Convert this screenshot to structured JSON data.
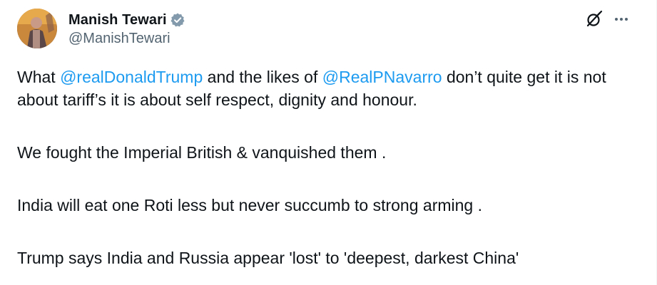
{
  "author": {
    "display_name": "Manish Tewari",
    "handle": "@ManishTewari",
    "verified_badge_color": "#1d9bf0"
  },
  "icons": {
    "grok": "grok-icon",
    "more": "more-options-icon",
    "verified": "verified-badge-icon"
  },
  "tweet": {
    "p1_before": "What ",
    "p1_mention1": "@realDonaldTrump",
    "p1_middle": " and the likes of ",
    "p1_mention2": "@RealPNavarro",
    "p1_after": " don’t quite get it is not about tariff’s it is about self respect, dignity and honour.",
    "p2": "We fought the Imperial British & vanquished them .",
    "p3": "India will eat one Roti less but never succumb to strong arming .",
    "p4": "Trump says India and Russia appear 'lost' to 'deepest, darkest China'"
  },
  "colors": {
    "text": "#0f1419",
    "secondary": "#536471",
    "link": "#1d9bf0"
  }
}
